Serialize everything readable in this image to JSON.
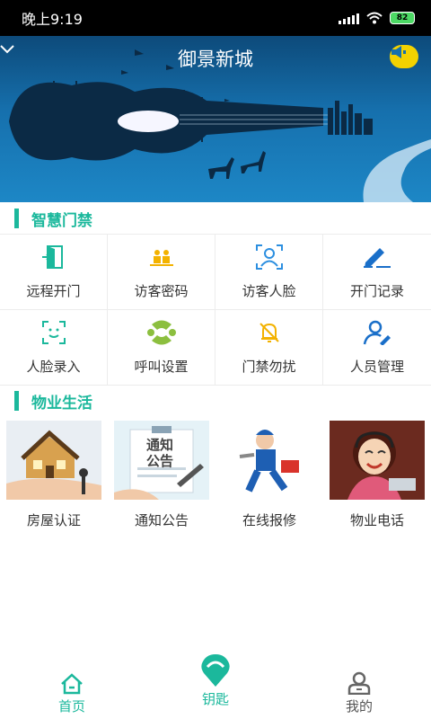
{
  "status_bar": {
    "time": "晚上9:19",
    "battery": "82"
  },
  "header": {
    "community_name": "御景新城"
  },
  "colors": {
    "accent": "#1bb89c",
    "banner": "#1670ad",
    "speaker": "#f3d200"
  },
  "sections": {
    "access": {
      "title": "智慧门禁"
    },
    "property": {
      "title": "物业生活"
    }
  },
  "access_grid": [
    {
      "label": "远程开门",
      "icon": "door-open-icon"
    },
    {
      "label": "访客密码",
      "icon": "visitor-password-icon"
    },
    {
      "label": "访客人脸",
      "icon": "face-user-icon"
    },
    {
      "label": "开门记录",
      "icon": "edit-record-icon"
    },
    {
      "label": "人脸录入",
      "icon": "face-scan-icon"
    },
    {
      "label": "呼叫设置",
      "icon": "call-settings-icon"
    },
    {
      "label": "门禁勿扰",
      "icon": "bell-off-icon"
    },
    {
      "label": "人员管理",
      "icon": "user-manage-icon"
    }
  ],
  "property_cards": [
    {
      "label": "房屋认证",
      "icon": "house-key-image"
    },
    {
      "label": "通知公告",
      "icon": "notice-board-image",
      "image_text": "通知公告"
    },
    {
      "label": "在线报修",
      "icon": "repairman-image"
    },
    {
      "label": "物业电话",
      "icon": "phone-operator-image"
    }
  ],
  "bottom_nav": {
    "home": "首页",
    "key": "钥匙",
    "mine": "我的"
  }
}
